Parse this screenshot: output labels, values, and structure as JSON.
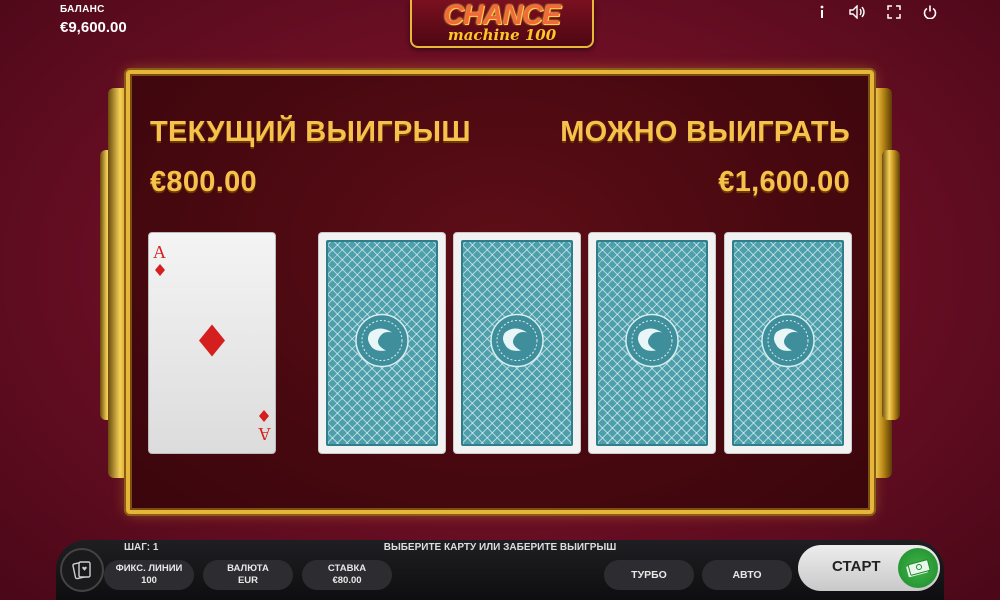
{
  "balance": {
    "label": "БАЛАНС",
    "value": "€9,600.00"
  },
  "logo": {
    "line1": "CHANCE",
    "line2": "machine 100"
  },
  "top_icons": [
    "info-icon",
    "sound-icon",
    "fullscreen-icon",
    "power-icon"
  ],
  "game": {
    "current_win_label": "ТЕКУЩИЙ ВЫИГРЫШ",
    "current_win_value": "€800.00",
    "potential_win_label": "МОЖНО ВЫИГРАТЬ",
    "potential_win_value": "€1,600.00"
  },
  "dealer_card": {
    "rank": "A",
    "suit": "diamonds"
  },
  "face_down_cards": 4,
  "bottom": {
    "step": "ШАГ: 1",
    "message": "ВЫБЕРИТЕ КАРТУ ИЛИ ЗАБЕРИТЕ ВЫИГРЫШ",
    "lines_label": "ФИКС. ЛИНИИ",
    "lines_value": "100",
    "currency_label": "ВАЛЮТА",
    "currency_value": "EUR",
    "bet_label": "СТАВКА",
    "bet_value": "€80.00",
    "turbo": "ТУРБО",
    "auto": "АВТО",
    "start": "СТАРТ"
  },
  "colors": {
    "gold": "#f7c24c",
    "felt": "#47080f",
    "card_back": "#4c9fab",
    "suit_red": "#d51f1f",
    "cash_green": "#2e9e3a"
  }
}
